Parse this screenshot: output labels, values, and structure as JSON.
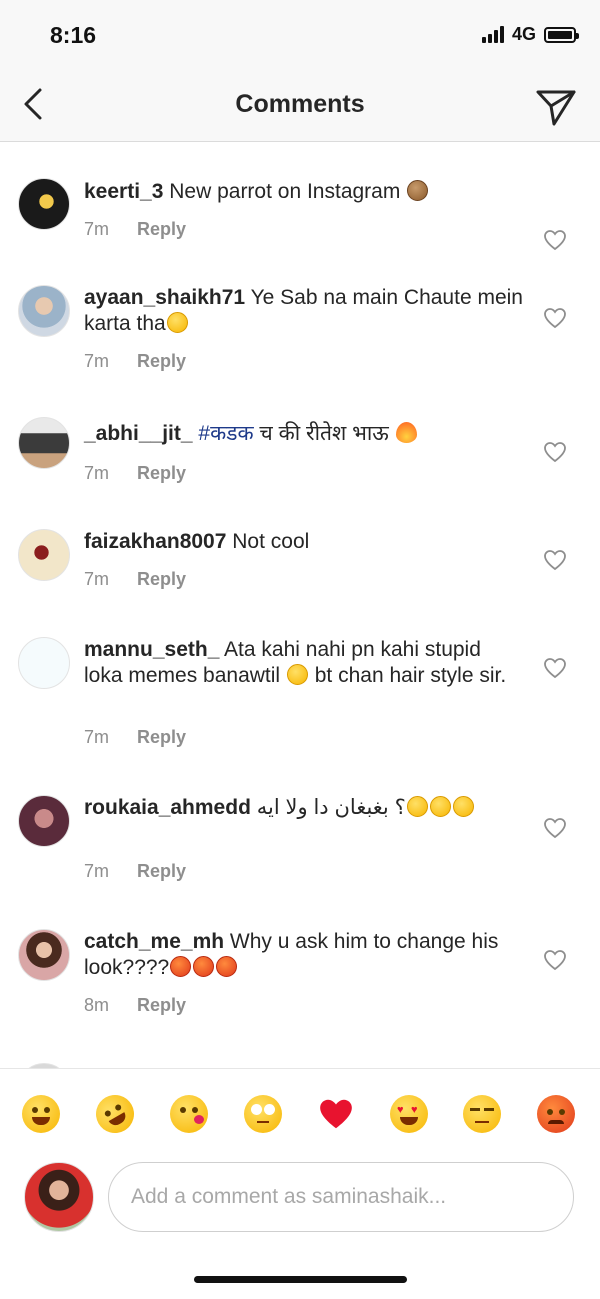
{
  "status_bar": {
    "time": "8:16",
    "network": "4G"
  },
  "header": {
    "title": "Comments",
    "back_icon": "chevron-left-icon",
    "send_icon": "paper-plane-icon"
  },
  "comments": [
    {
      "username": "keerti_3",
      "text": " New parrot on Instagram ",
      "emojis": [
        "see-no-evil-monkey"
      ],
      "time": "7m",
      "reply": "Reply"
    },
    {
      "username": "ayaan_shaikh71",
      "text": " Ye Sab na main Chaute mein karta tha",
      "emojis": [
        "laughing"
      ],
      "time": "7m",
      "reply": "Reply"
    },
    {
      "username": "_abhi__jit_",
      "hashtag": " #कडक",
      "text": " च की रीतेश भाऊ ",
      "emojis": [
        "fire"
      ],
      "time": "7m",
      "reply": "Reply"
    },
    {
      "username": "faizakhan8007",
      "text": " Not cool",
      "time": "7m",
      "reply": "Reply"
    },
    {
      "username": "mannu_seth_",
      "text": " Ata kahi nahi pn kahi stupid loka memes banawtil ",
      "text2": " bt chan hair style sir.",
      "emojis": [
        "winking-tongue"
      ],
      "time": "7m",
      "reply": "Reply"
    },
    {
      "username": "roukaia_ahmedd",
      "text": " ؟ بغبغان دا ولا ايه",
      "emojis": [
        "laughing",
        "laughing",
        "laughing"
      ],
      "time": "7m",
      "reply": "Reply"
    },
    {
      "username": "catch_me_mh",
      "text": " Why u ask him to change his look????",
      "emojis": [
        "angry",
        "angry",
        "angry"
      ],
      "time": "8m",
      "reply": "Reply"
    }
  ],
  "emoji_bar": [
    "laughing",
    "rolling-laughing",
    "kissing",
    "eye-roll",
    "red-heart",
    "heart-eyes",
    "unamused",
    "angry"
  ],
  "composer": {
    "placeholder": "Add a comment as saminashaik..."
  },
  "colors": {
    "accent_hashtag": "#1e3a8a",
    "text": "#262626",
    "secondary": "#8e8e8e",
    "heart": "#ed4956"
  }
}
